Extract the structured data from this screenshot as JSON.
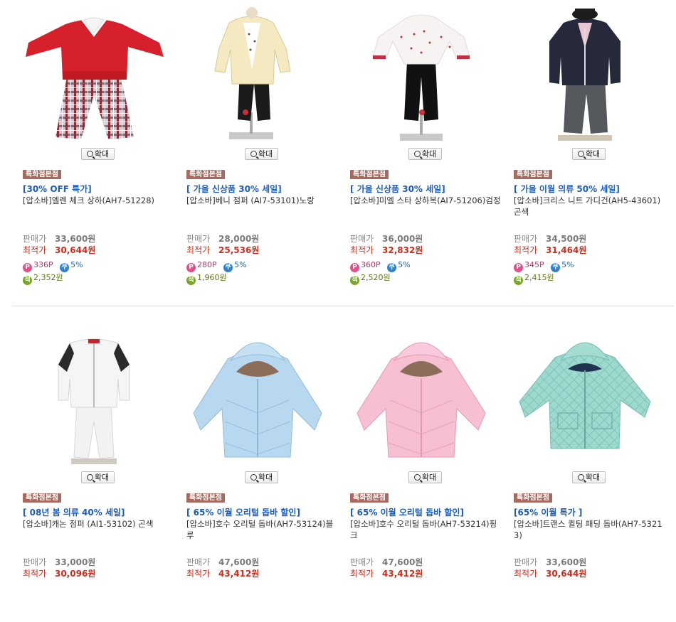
{
  "common": {
    "zoom_label": "확대",
    "badge_label": "특화점본점",
    "sale_price_label": "판매가",
    "best_price_label": "최적가",
    "point_icon_char": "P",
    "coupon_icon_char": "쿠",
    "saving_icon_char": "적"
  },
  "products": [
    {
      "promo": "[30% OFF 특가]",
      "name": "[압소바]엘렌 체크 상하(AH7-51228)",
      "sale_price": "33,600원",
      "best_price": "30,644원",
      "points": "336P",
      "coupon": "5%",
      "saving": "2,352원",
      "image": "red-sweater-plaid-pants"
    },
    {
      "promo": "[ 가을 신상품 30% 세일]",
      "name": "[압소바]베니 점퍼 (AI7-53101)노랑",
      "sale_price": "28,000원",
      "best_price": "25,536원",
      "points": "280P",
      "coupon": "5%",
      "saving": "1,960원",
      "image": "cream-hooded-jacket-set"
    },
    {
      "promo": "[ 가을 신상품 30% 세일]",
      "name": "[압소바]미엘 스타 상하복(AI7-51206)검정",
      "sale_price": "36,000원",
      "best_price": "32,832원",
      "points": "360P",
      "coupon": "5%",
      "saving": "2,520원",
      "image": "star-top-black-pants"
    },
    {
      "promo": "[ 가을 이월 의류 50% 세일]",
      "name": "[압소바]크리스 니트 가디건(AH5-43601)곤색",
      "sale_price": "34,500원",
      "best_price": "31,464원",
      "points": "345P",
      "coupon": "5%",
      "saving": "2,415원",
      "image": "navy-knit-cardigan-set"
    },
    {
      "promo": "[ 08년 봄 의류 40% 세일]",
      "name": "[압소바]캐논 점퍼 (AI1-53102) 곤색",
      "sale_price": "33,000원",
      "best_price": "30,096원",
      "points": "",
      "coupon": "",
      "saving": "",
      "image": "white-jacket-set"
    },
    {
      "promo": "[ 65% 이월 오리털 돕바 할인]",
      "name": "[압소바]호수 오리털 돕바(AH7-53124)블루",
      "sale_price": "47,600원",
      "best_price": "43,412원",
      "points": "",
      "coupon": "",
      "saving": "",
      "image": "blue-down-jacket"
    },
    {
      "promo": "[ 65% 이월 오리털 돕바 할인]",
      "name": "[압소바]호수 오리털 돕바(AH7-53214)핑크",
      "sale_price": "47,600원",
      "best_price": "43,412원",
      "points": "",
      "coupon": "",
      "saving": "",
      "image": "pink-down-jacket"
    },
    {
      "promo": "[65% 이월 특가 ]",
      "name": "[압소바]트랜스 퀼팅 패딩 돕바(AH7-53213)",
      "sale_price": "33,600원",
      "best_price": "30,644원",
      "points": "",
      "coupon": "",
      "saving": "",
      "image": "mint-quilted-jacket"
    }
  ],
  "colors": {
    "promo_link": "#1a5dbf",
    "best_price": "#d12a1a",
    "badge_bg": "#a8695e",
    "point_icon": "#e0508a",
    "coupon_icon": "#2f82d1",
    "saving_icon": "#7aa826"
  }
}
